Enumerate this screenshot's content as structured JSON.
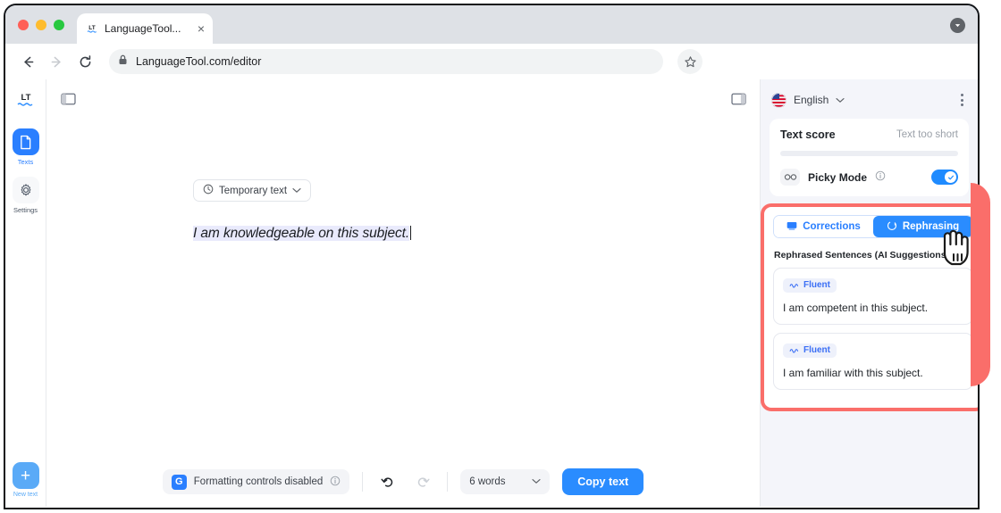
{
  "browser": {
    "tab": {
      "title": "LanguageTool...",
      "favicon": "lt-favicon",
      "close": "×"
    },
    "nav": {
      "back": "back-arrow",
      "forward": "forward-arrow",
      "reload": "reload-arrow"
    },
    "omnibox": {
      "url": "LanguageTool.com/editor",
      "lock": "lock-icon"
    },
    "bookmark": "star-icon",
    "window_menu": "chevron-down-icon"
  },
  "rail": {
    "logo": "LT",
    "items": [
      {
        "label": "Texts",
        "icon": "document-icon",
        "active": true
      },
      {
        "label": "Settings",
        "icon": "gear-icon",
        "active": false
      }
    ],
    "new_text": {
      "label": "New text",
      "icon": "plus-icon"
    }
  },
  "editor": {
    "panel_toggle_left": "panel-left-icon",
    "panel_toggle_right": "panel-right-icon",
    "chip": {
      "label": "Temporary text",
      "icon": "clock-icon",
      "caret": "chevron-down-icon"
    },
    "text": "I am knowledgeable on this subject."
  },
  "bottombar": {
    "formatting": {
      "badge": "G",
      "label": "Formatting controls disabled",
      "info": "info-icon"
    },
    "undo": "undo-icon",
    "redo": "redo-icon",
    "word_count": {
      "value": "6 words",
      "caret": "chevron-down-icon"
    },
    "copy_label": "Copy text"
  },
  "sidebar": {
    "language": {
      "name": "English",
      "flag": "us-flag-icon",
      "caret": "chevron-down-icon"
    },
    "menu": "kebab-menu-icon",
    "score": {
      "title": "Text score",
      "status": "Text too short",
      "progress": 0
    },
    "picky": {
      "label": "Picky Mode",
      "icon": "glasses-icon",
      "info": "info-icon",
      "enabled": true
    },
    "tabs": [
      {
        "label": "Corrections",
        "icon": "corrections-icon",
        "active": false
      },
      {
        "label": "Rephrasing",
        "icon": "rephrasing-icon",
        "active": true
      }
    ],
    "suggestions_title": "Rephrased Sentences (AI Suggestions)",
    "suggestions": [
      {
        "tag": "Fluent",
        "text": "I am competent in this subject."
      },
      {
        "tag": "Fluent",
        "text": "I am familiar with this subject."
      }
    ]
  },
  "colors": {
    "accent": "#2a8cff",
    "highlight": "#fa6e6a",
    "sidebar_bg": "#f4f5fa"
  }
}
